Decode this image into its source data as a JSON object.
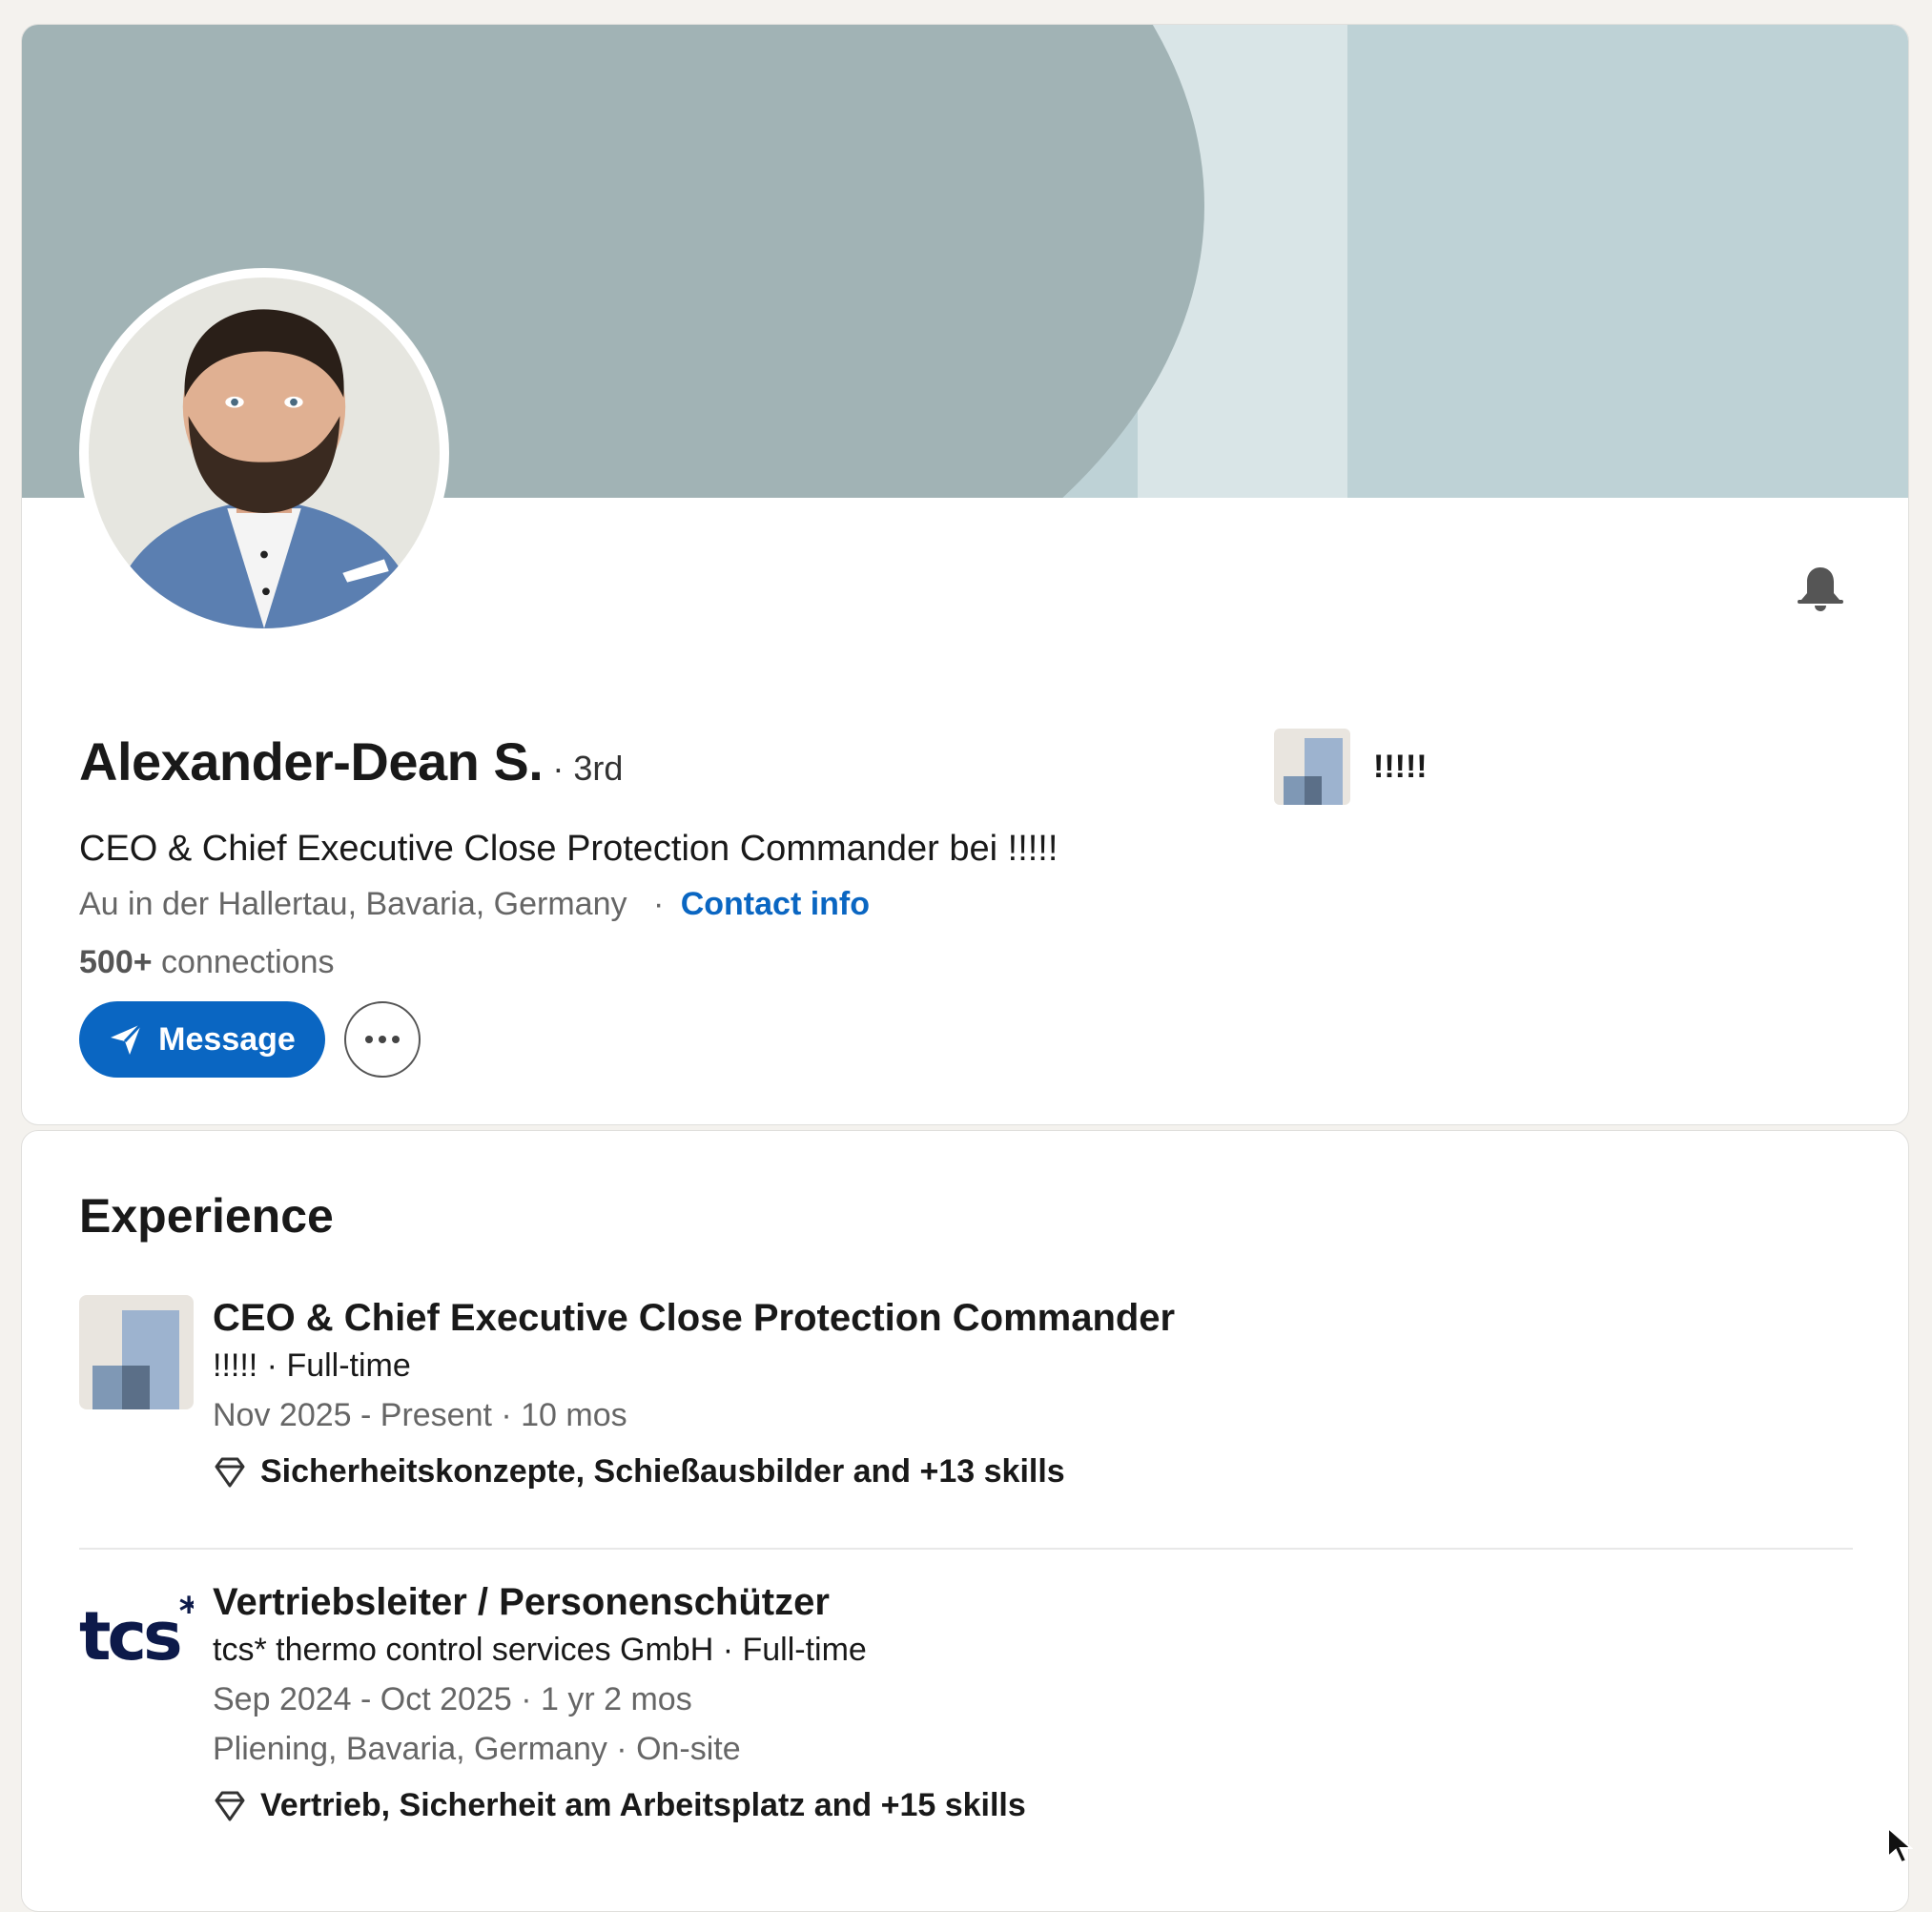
{
  "profile": {
    "name": "Alexander-Dean S.",
    "degree": "· 3rd",
    "headline": "CEO & Chief Executive Close Protection Commander bei !!!!!",
    "location": "Au in der Hallertau, Bavaria, Germany",
    "location_sep": "·",
    "contact_label": "Contact info",
    "connections_count": "500+",
    "connections_label": "connections",
    "message_label": "Message",
    "current_company": "!!!!!"
  },
  "colors": {
    "brand_blue": "#0a66c2",
    "banner_dark": "#a1b3b5",
    "banner_light": "#bed2d6"
  },
  "experience": {
    "title": "Experience",
    "items": [
      {
        "role": "CEO & Chief Executive Close Protection Commander",
        "company_line": "!!!!! · Full-time",
        "dates": "Nov 2025 - Present · 10 mos",
        "skills": "Sicherheitskonzepte, Schießausbilder and +13 skills"
      },
      {
        "role": "Vertriebsleiter / Personenschützer",
        "company_line": "tcs* thermo control services GmbH · Full-time",
        "dates": "Sep 2024 - Oct 2025 · 1 yr 2 mos",
        "location": "Pliening, Bavaria, Germany · On-site",
        "skills": "Vertrieb, Sicherheit am Arbeitsplatz and +15 skills",
        "logo_text": "tcs",
        "logo_mark": "*"
      }
    ]
  }
}
